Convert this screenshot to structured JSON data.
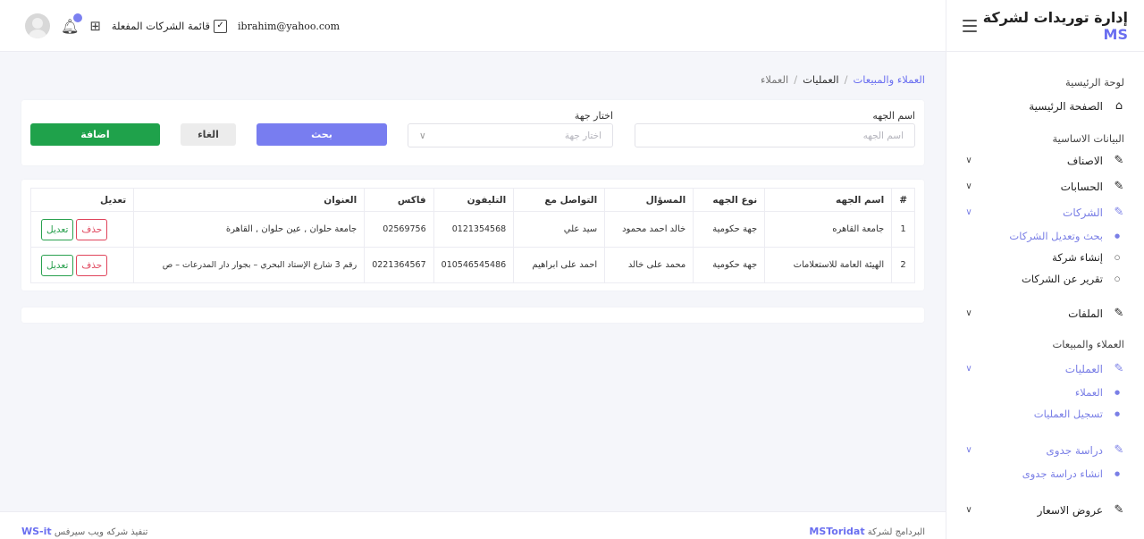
{
  "brand": {
    "prefix": "إدارة توريدات لشركة",
    "accent": "MS"
  },
  "topbar": {
    "email": "ibrahim@yahoo.com",
    "active_companies": "قائمة الشركات المفعلة"
  },
  "sidebar": {
    "dashboard_head": "لوحة الرئيسية",
    "home": "الصفحة الرئيسية",
    "basic_head": "البيانات الاساسية",
    "items": [
      "الاصناف",
      "الحسابات",
      "الشركات"
    ],
    "companies_sub": [
      "بحث وتعديل الشركات",
      "إنشاء شركة",
      "تقرير عن الشركات"
    ],
    "files": "الملفات",
    "clients_head": "العملاء والمبيعات",
    "operations": "العمليات",
    "operations_sub": [
      "العملاء",
      "تسجيل العمليات"
    ],
    "feasibility": "دراسة جدوى",
    "feasibility_sub": [
      "انشاء دراسة جدوى"
    ],
    "quotes": "عروض الاسعار"
  },
  "breadcrumb": {
    "root": "العملاء والمبيعات",
    "mid": "العمليات",
    "current": "العملاء"
  },
  "form": {
    "name_label": "اسم الجهه",
    "name_placeholder": "اسم الجهه",
    "select_label": "اختار جهة",
    "select_placeholder": "اختار جهة",
    "search_btn": "بحث",
    "cancel_btn": "الغاء",
    "add_btn": "اضافة"
  },
  "table": {
    "headers": [
      "#",
      "اسم الجهه",
      "نوع الجهه",
      "المسؤال",
      "التواصل مع",
      "التليفون",
      "فاكس",
      "العنوان",
      "تعديل"
    ],
    "rows": [
      [
        "1",
        "جامعة القاهره",
        "جهة حكومية",
        "خالد احمد محمود",
        "سيد علي",
        "0121354568",
        "02569756",
        "جامعة حلوان , عين حلوان , القاهرة"
      ],
      [
        "2",
        "الهيئة العامة للاستعلامات",
        "جهة حكومية",
        "محمد على خالد",
        "احمد على ابراهيم",
        "010546545486",
        "0221364567",
        "رقم 3 شارع الإستاد البحري – بجوار دار المدرعات – ص"
      ]
    ],
    "edit_label": "تعديل",
    "delete_label": "حذف"
  },
  "footer": {
    "right_text": "البردامج لشركة",
    "right_link": "MSToridat",
    "left_text": "تنفيذ شركه ويب سيرفس",
    "left_link": "WS-it"
  }
}
